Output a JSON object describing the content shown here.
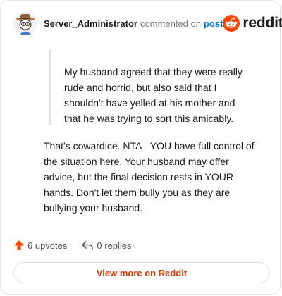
{
  "header": {
    "username": "Server_Administrator",
    "commented_text": "commented on",
    "post_link": "post",
    "brand_word": "reddit",
    "brand_color": "#ff4500"
  },
  "quote": {
    "text": "My husband agreed that they were really rude and horrid, but also said that I shouldn't have yelled at his mother and that he was trying to sort this amicably."
  },
  "comment": {
    "text": "That's cowardice. NTA - YOU have full control of the situation here. Your husband may offer advice, but the final decision rests in YOUR hands. Don't let them bully you as they are bullying your husband."
  },
  "actions": {
    "upvotes": "6 upvotes",
    "replies": "0 replies",
    "upvote_icon": "upvote-arrow-icon",
    "reply_icon": "reply-arrow-icon"
  },
  "footer": {
    "view_more": "View more on Reddit",
    "accent": "#d93a00"
  }
}
